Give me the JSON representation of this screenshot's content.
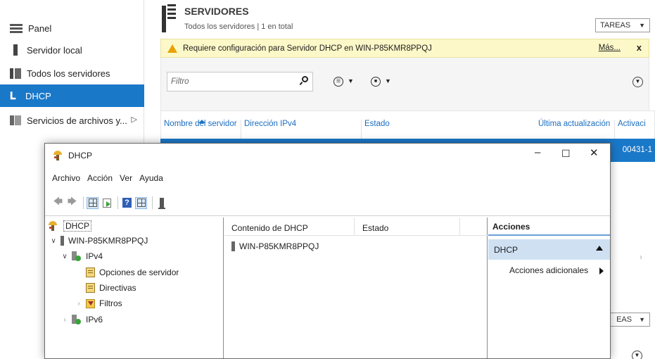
{
  "sidebar": {
    "items": [
      {
        "label": "Panel"
      },
      {
        "label": "Servidor local"
      },
      {
        "label": "Todos los servidores"
      },
      {
        "label": "DHCP"
      },
      {
        "label": "Servicios de archivos y..."
      }
    ]
  },
  "header": {
    "title": "SERVIDORES",
    "subtitle": "Todos los servidores | 1 en total",
    "tasks_label": "TAREAS",
    "tasks_label_2": "EAS"
  },
  "warning": {
    "text": "Requiere configuración para Servidor DHCP en WIN-P85KMR8PPQJ",
    "more_link": "Más...",
    "close": "x"
  },
  "filter": {
    "placeholder": "Filtro"
  },
  "columns": [
    "Nombre del servidor",
    "Dirección IPv4",
    "Estado",
    "Última actualización",
    "Activaci"
  ],
  "selected_row_fragment": "00431-1",
  "dhcp_window": {
    "title": "DHCP",
    "menu": [
      "Archivo",
      "Acción",
      "Ver",
      "Ayuda"
    ],
    "tree": {
      "root": "DHCP",
      "server": "WIN-P85KMR8PPQJ",
      "ipv4": "IPv4",
      "server_options": "Opciones de servidor",
      "policies": "Directivas",
      "filters": "Filtros",
      "ipv6": "IPv6"
    },
    "content": {
      "col_contents": "Contenido de DHCP",
      "col_status": "Estado",
      "rows": [
        "WIN-P85KMR8PPQJ"
      ]
    },
    "actions": {
      "title": "Acciones",
      "section": "DHCP",
      "item": "Acciones adicionales"
    }
  },
  "colors": {
    "accent": "#1a78c8",
    "warning_bg": "#fdf8c8",
    "actions_section_bg": "#cfe0f3"
  }
}
